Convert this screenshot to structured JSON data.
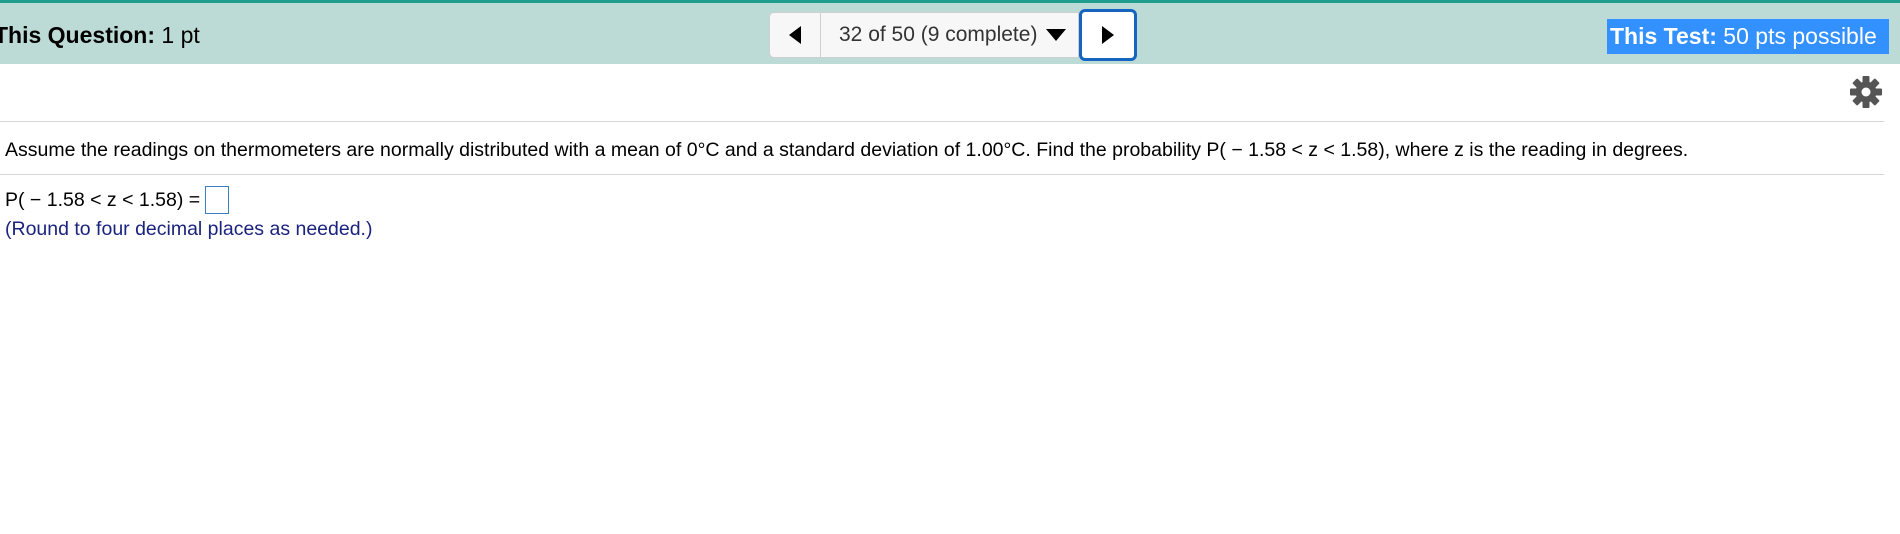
{
  "header": {
    "question_label": "This Question:",
    "question_points": " 1 pt",
    "nav_position": "32 of 50 (9 complete)",
    "test_label": "This Test:",
    "test_points": " 50 pts possible"
  },
  "question": {
    "text": "Assume the readings on thermometers are normally distributed with a mean of 0°C and a standard deviation of 1.00°C. Find the probability P( − 1.58 < z < 1.58), where z  is the reading in degrees.",
    "answer_prefix": "P( − 1.58 < z < 1.58) =",
    "answer_value": "",
    "hint": "(Round to four decimal places as needed.)"
  },
  "icons": {
    "prev": "triangle-left-icon",
    "next": "triangle-right-icon",
    "dropdown": "caret-down-icon",
    "settings": "gear-icon"
  },
  "colors": {
    "topbar": "#bcdad6",
    "topbar_accent": "#1f9e8e",
    "highlight": "#3391ff",
    "focus_border": "#1565c0",
    "hint_text": "#1a237e"
  }
}
